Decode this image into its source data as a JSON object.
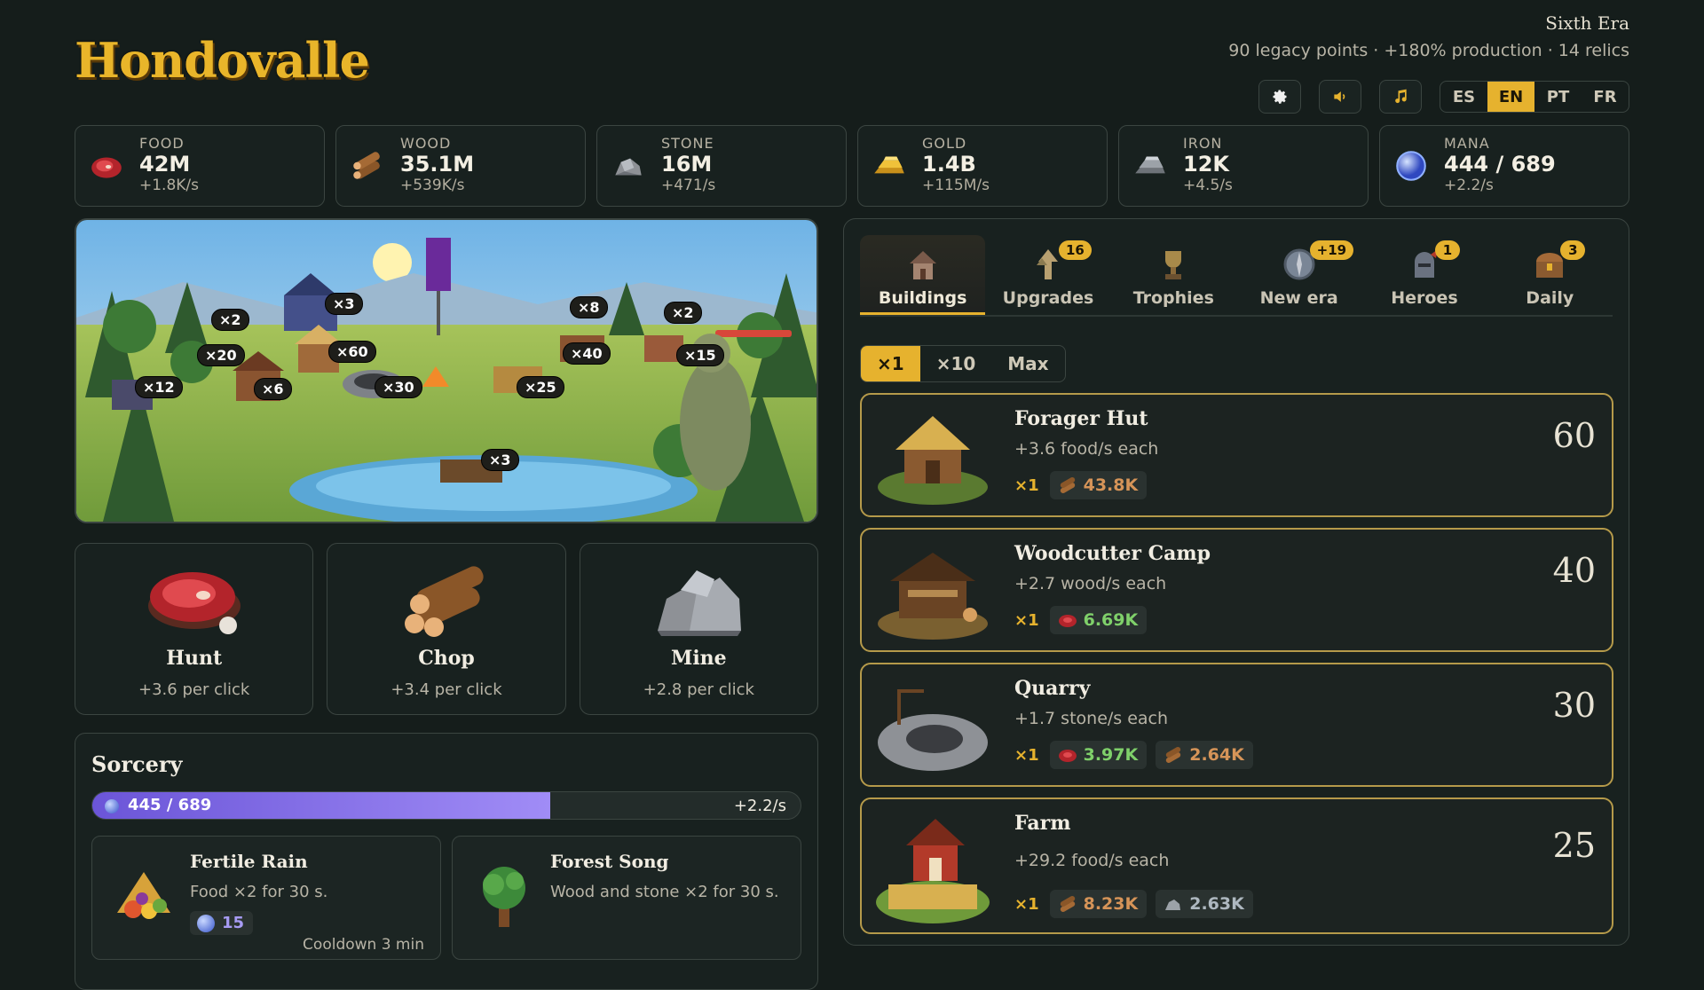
{
  "header": {
    "logo": "Hondovalle",
    "era_title": "Sixth Era",
    "era_summary": "90 legacy points · +180% production · 14 relics",
    "languages": [
      {
        "code": "ES",
        "active": false
      },
      {
        "code": "EN",
        "active": true
      },
      {
        "code": "PT",
        "active": false
      },
      {
        "code": "FR",
        "active": false
      }
    ]
  },
  "resources": [
    {
      "name": "FOOD",
      "value": "42M",
      "rate": "+1.8K/s",
      "icon": "meat-icon"
    },
    {
      "name": "WOOD",
      "value": "35.1M",
      "rate": "+539K/s",
      "icon": "logs-icon"
    },
    {
      "name": "STONE",
      "value": "16M",
      "rate": "+471/s",
      "icon": "stone-icon"
    },
    {
      "name": "GOLD",
      "value": "1.4B",
      "rate": "+115M/s",
      "icon": "gold-icon"
    },
    {
      "name": "IRON",
      "value": "12K",
      "rate": "+4.5/s",
      "icon": "iron-icon"
    },
    {
      "name": "MANA",
      "value": "444 / 689",
      "rate": "+2.2/s",
      "icon": "mana-orb-icon"
    }
  ],
  "scene": {
    "tags": [
      "×2",
      "×3",
      "×8",
      "×2",
      "×20",
      "×60",
      "×40",
      "×15",
      "×12",
      "×6",
      "×30",
      "×25",
      "×3"
    ]
  },
  "actions": [
    {
      "name": "Hunt",
      "rate": "+3.6 per click"
    },
    {
      "name": "Chop",
      "rate": "+3.4 per click"
    },
    {
      "name": "Mine",
      "rate": "+2.8 per click"
    }
  ],
  "sorcery": {
    "title": "Sorcery",
    "mana_text": "445 / 689",
    "mana_fraction": 0.646,
    "mana_rate": "+2.2/s",
    "spells": [
      {
        "name": "Fertile Rain",
        "desc": "Food ×2 for 30 s.",
        "cost": "15",
        "cooldown": "Cooldown 3 min"
      },
      {
        "name": "Forest Song",
        "desc": "Wood and stone ×2 for 30 s."
      }
    ]
  },
  "tabs": [
    {
      "label": "Buildings",
      "badge": "",
      "active": true
    },
    {
      "label": "Upgrades",
      "badge": "16"
    },
    {
      "label": "Trophies",
      "badge": ""
    },
    {
      "label": "New era",
      "badge": "+19"
    },
    {
      "label": "Heroes",
      "badge": "1"
    },
    {
      "label": "Daily",
      "badge": "3"
    }
  ],
  "multipliers": [
    {
      "label": "×1",
      "active": true
    },
    {
      "label": "×10",
      "active": false
    },
    {
      "label": "Max",
      "active": false
    }
  ],
  "buildings": [
    {
      "name": "Forager Hut",
      "desc": "+3.6 food/s each",
      "count": "60",
      "qty": "×1",
      "costs": [
        {
          "type": "wood",
          "value": "43.8K"
        }
      ]
    },
    {
      "name": "Woodcutter Camp",
      "desc": "+2.7 wood/s each",
      "count": "40",
      "qty": "×1",
      "costs": [
        {
          "type": "food",
          "value": "6.69K"
        }
      ]
    },
    {
      "name": "Quarry",
      "desc": "+1.7 stone/s each",
      "count": "30",
      "qty": "×1",
      "costs": [
        {
          "type": "food",
          "value": "3.97K"
        },
        {
          "type": "wood",
          "value": "2.64K"
        }
      ]
    },
    {
      "name": "Farm",
      "desc": "+29.2 food/s each",
      "count": "25",
      "qty": "×1",
      "costs": [
        {
          "type": "wood",
          "value": "8.23K"
        },
        {
          "type": "stone",
          "value": "2.63K"
        }
      ]
    }
  ]
}
